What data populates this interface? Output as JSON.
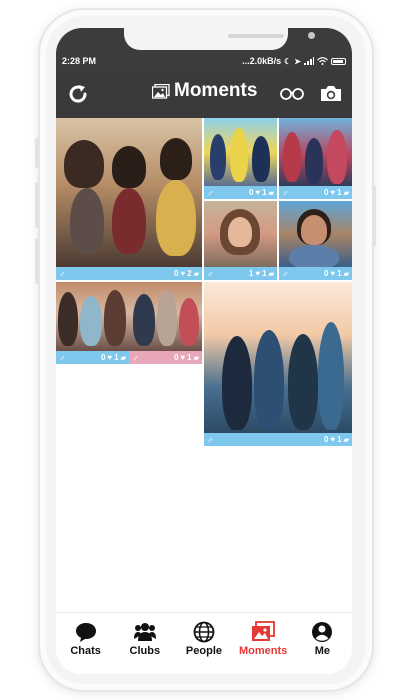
{
  "status_bar": {
    "time": "2:28 PM",
    "speed": "...2.0kB/s",
    "icons": [
      "moon-icon",
      "location-icon",
      "signal-icon",
      "wifi-icon",
      "battery-icon"
    ]
  },
  "app_bar": {
    "title": "Moments",
    "icons": [
      "refresh-icon",
      "photo-icon",
      "glasses-icon",
      "camera-icon"
    ]
  },
  "moments": [
    {
      "gender": "♂",
      "likes": "0",
      "comments": "2",
      "bar_color": "#7ec8ee"
    },
    {
      "gender": "♂",
      "likes": "0",
      "comments": "1",
      "bar_color": "#7ec8ee"
    },
    {
      "gender": "♂",
      "likes": "0",
      "comments": "1",
      "bar_color": "#7ec8ee"
    },
    {
      "gender": "♂",
      "likes": "1",
      "comments": "1",
      "bar_color": "#7ec8ee"
    },
    {
      "gender": "♂",
      "likes": "0",
      "comments": "1",
      "bar_color": "#7ec8ee"
    },
    {
      "gender": "♂",
      "likes": "0",
      "comments": "1",
      "bar_color": "#7ec8ee"
    },
    {
      "gender": "♂",
      "likes": "0",
      "comments": "1",
      "bar_color": "#e8a7b8"
    },
    {
      "gender": "♂",
      "likes": "0",
      "comments": "1",
      "bar_color": "#7ec8ee"
    }
  ],
  "bottom_nav": {
    "items": [
      {
        "label": "Chats",
        "icon": "chat-bubble-icon",
        "active": false
      },
      {
        "label": "Clubs",
        "icon": "group-icon",
        "active": false
      },
      {
        "label": "People",
        "icon": "globe-icon",
        "active": false
      },
      {
        "label": "Moments",
        "icon": "photos-icon",
        "active": true
      },
      {
        "label": "Me",
        "icon": "person-icon",
        "active": false
      }
    ],
    "active_color": "#e53935"
  }
}
